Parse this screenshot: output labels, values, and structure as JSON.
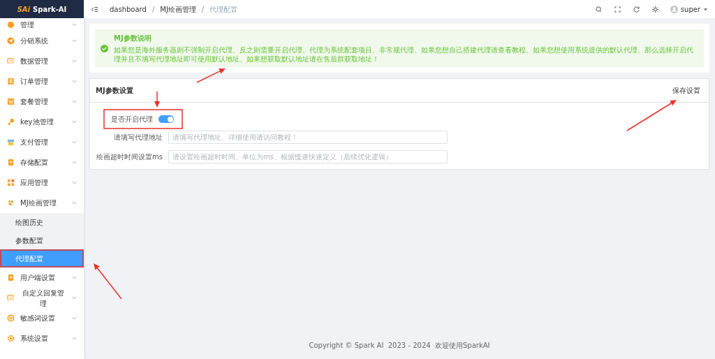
{
  "logo": {
    "mark": "SAi",
    "name": "Spark-AI"
  },
  "sidebar": {
    "items": [
      {
        "label": "管理",
        "expanded": false
      },
      {
        "label": "分销系统",
        "expanded": false
      },
      {
        "label": "数据管理",
        "expanded": false
      },
      {
        "label": "订单管理",
        "expanded": false
      },
      {
        "label": "套餐管理",
        "expanded": false
      },
      {
        "label": "key池管理",
        "expanded": false
      },
      {
        "label": "支付管理",
        "expanded": false
      },
      {
        "label": "存储配置",
        "expanded": false
      },
      {
        "label": "应用管理",
        "expanded": false
      },
      {
        "label": "MJ绘画管理",
        "expanded": true,
        "children": [
          {
            "label": "绘图历史",
            "selected": false
          },
          {
            "label": "参数配置",
            "selected": false
          },
          {
            "label": "代理配置",
            "selected": true
          }
        ]
      },
      {
        "label": "用户端设置",
        "expanded": false
      },
      {
        "label": "自定义回复管理",
        "expanded": false
      },
      {
        "label": "敏感词设置",
        "expanded": false
      },
      {
        "label": "系统设置",
        "expanded": false
      }
    ]
  },
  "breadcrumb": [
    {
      "kind": "link",
      "text": "dashboard"
    },
    {
      "kind": "separator",
      "text": "/"
    },
    {
      "kind": "link",
      "text": "MJ绘画管理"
    },
    {
      "kind": "separator",
      "text": "/"
    },
    {
      "kind": "current",
      "text": "代理配置"
    }
  ],
  "user": {
    "name": "super"
  },
  "alert": {
    "title": "MJ参数说明",
    "text": "如果您是海外服务器则不强制开启代理、反之则需要开启代理、代理为系统配套项目、非常规代理、如果您想自己搭建代理请查看教程、如果您想使用系统提供的默认代理、那么选择开启代理并且不填写代理地址即可使用默认地址、如果想获取默认地址请在售后群获取地址！"
  },
  "settings": {
    "title": "MJ参数设置",
    "save": "保存设置",
    "fields": [
      {
        "kind": "switch",
        "label": "是否开启代理",
        "on": true
      },
      {
        "kind": "input",
        "label": "请填写代理地址",
        "placeholder": "请填写代理地址、详细使用请访问教程！"
      },
      {
        "kind": "input",
        "label": "绘画超时时间设置ms",
        "placeholder": "请设置绘画超时时间、单位为ms、根据慢速快速定义（后续优化逻辑）"
      }
    ]
  },
  "footer": "Copyright © Spark AI  2023 - 2024  欢迎使用SparkAI"
}
